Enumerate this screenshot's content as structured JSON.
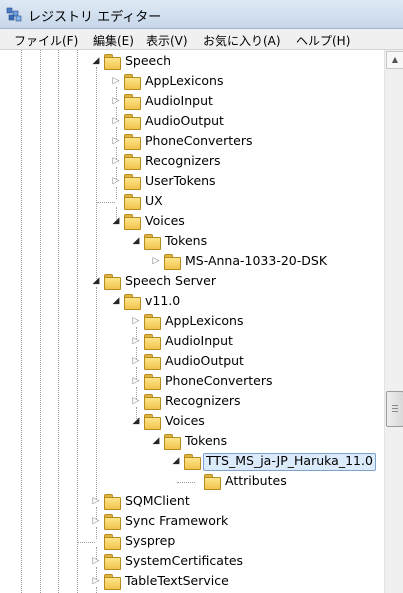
{
  "window": {
    "title": "レジストリ エディター"
  },
  "menu": [
    "ファイル(F)",
    "編集(E)",
    "表示(V)",
    "お気に入り(A)",
    "ヘルプ(H)"
  ],
  "tree": [
    {
      "label": "Speech",
      "level": 0,
      "toggle": "expanded"
    },
    {
      "label": "AppLexicons",
      "level": 1,
      "toggle": "collapsed"
    },
    {
      "label": "AudioInput",
      "level": 1,
      "toggle": "collapsed"
    },
    {
      "label": "AudioOutput",
      "level": 1,
      "toggle": "collapsed"
    },
    {
      "label": "PhoneConverters",
      "level": 1,
      "toggle": "collapsed"
    },
    {
      "label": "Recognizers",
      "level": 1,
      "toggle": "collapsed"
    },
    {
      "label": "UserTokens",
      "level": 1,
      "toggle": "collapsed"
    },
    {
      "label": "UX",
      "level": 1,
      "toggle": "none"
    },
    {
      "label": "Voices",
      "level": 1,
      "toggle": "expanded"
    },
    {
      "label": "Tokens",
      "level": 2,
      "toggle": "expanded"
    },
    {
      "label": "MS-Anna-1033-20-DSK",
      "level": 3,
      "toggle": "collapsed"
    },
    {
      "label": "Speech Server",
      "level": 0,
      "toggle": "expanded"
    },
    {
      "label": "v11.0",
      "level": 1,
      "toggle": "expanded"
    },
    {
      "label": "AppLexicons",
      "level": 2,
      "toggle": "collapsed"
    },
    {
      "label": "AudioInput",
      "level": 2,
      "toggle": "collapsed"
    },
    {
      "label": "AudioOutput",
      "level": 2,
      "toggle": "collapsed"
    },
    {
      "label": "PhoneConverters",
      "level": 2,
      "toggle": "collapsed"
    },
    {
      "label": "Recognizers",
      "level": 2,
      "toggle": "collapsed"
    },
    {
      "label": "Voices",
      "level": 2,
      "toggle": "expanded"
    },
    {
      "label": "Tokens",
      "level": 3,
      "toggle": "expanded"
    },
    {
      "label": "TTS_MS_ja-JP_Haruka_11.0",
      "level": 4,
      "toggle": "expanded",
      "selected": true
    },
    {
      "label": "Attributes",
      "level": 5,
      "toggle": "none"
    },
    {
      "label": "SQMClient",
      "level": 0,
      "toggle": "collapsed"
    },
    {
      "label": "Sync Framework",
      "level": 0,
      "toggle": "collapsed"
    },
    {
      "label": "Sysprep",
      "level": 0,
      "toggle": "none"
    },
    {
      "label": "SystemCertificates",
      "level": 0,
      "toggle": "collapsed"
    },
    {
      "label": "TableTextService",
      "level": 0,
      "toggle": "collapsed"
    }
  ],
  "icons": {
    "app": "regedit-icon",
    "folder": "folder-icon",
    "expanded": "expanded-triangle-icon",
    "collapsed": "collapsed-triangle-icon"
  },
  "scrollbar": {
    "position": 0.62
  },
  "colors": {
    "selection_bg": "#dcebfc",
    "selection_border": "#7da2ce",
    "folder": "#f0c34d"
  }
}
